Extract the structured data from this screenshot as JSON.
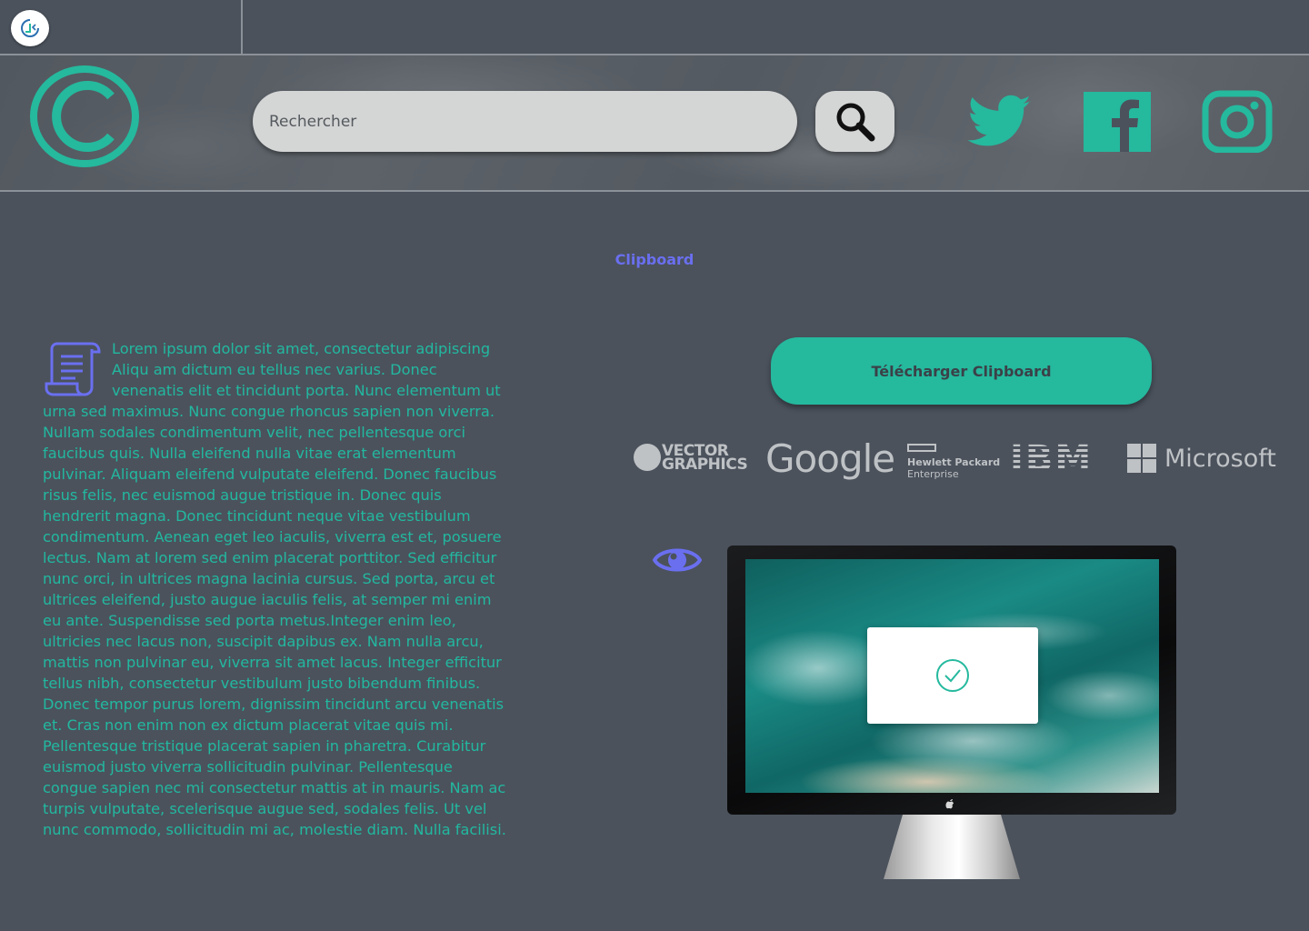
{
  "search": {
    "placeholder": "Rechercher"
  },
  "main": {
    "title": "Clipboard",
    "body_text": "Lorem ipsum dolor sit amet, consectetur adipiscing Aliqu am dictum eu tellus nec varius. Donec venenatis elit et tincidunt porta. Nunc elementum ut urna sed maximus. Nunc congue rhoncus sapien non viverra. Nullam sodales condimentum velit, nec pellentesque orci faucibus quis. Nulla eleifend nulla vitae erat elementum pulvinar. Aliquam eleifend vulputate eleifend. Donec faucibus risus felis, nec euismod augue tristique in. Donec quis hendrerit magna. Donec tincidunt neque vitae vestibulum condimentum. Aenean eget leo iaculis, viverra est et, posuere lectus. Nam at lorem sed enim placerat porttitor. Sed efficitur nunc orci, in ultrices magna lacinia cursus. Sed porta, arcu et ultrices eleifend, justo augue iaculis felis, at semper mi enim eu ante. Suspendisse sed porta metus.Integer enim leo, ultricies nec lacus non, suscipit dapibus ex. Nam nulla arcu, mattis non pulvinar eu, viverra sit amet lacus. Integer efficitur tellus nibh, consectetur vestibulum justo bibendum finibus. Donec tempor purus lorem, dignissim tincidunt arcu venenatis et. Cras non enim non ex dictum placerat vitae quis mi. Pellentesque tristique placerat sapien in pharetra. Curabitur euismod justo viverra sollicitudin pulvinar. Pellentesque congue sapien nec mi consectetur mattis at in mauris. Nam ac turpis vulputate, scelerisque augue sed, sodales felis. Ut vel nunc commodo, sollicitudin mi ac, molestie diam. Nulla facilisi.",
    "download_label": "Télécharger Clipboard"
  },
  "brands": {
    "vector_graphics_line1": "VECTOR",
    "vector_graphics_line2": "GRAPHICS",
    "google": "Google",
    "hpe_line1": "Hewlett Packard",
    "hpe_line2": "Enterprise",
    "ibm": "IBM",
    "microsoft": "Microsoft"
  },
  "colors": {
    "background": "#4b525c",
    "accent_teal": "#25b99e",
    "accent_violet": "#6a6ff0",
    "text_teal": "#22b8a0",
    "brand_gray": "#bfc2c5"
  },
  "icons": [
    "app-logo-icon",
    "copyright-logo-icon",
    "search-icon",
    "twitter-icon",
    "facebook-icon",
    "instagram-icon",
    "scroll-icon",
    "eye-icon",
    "check-icon",
    "apple-icon"
  ]
}
